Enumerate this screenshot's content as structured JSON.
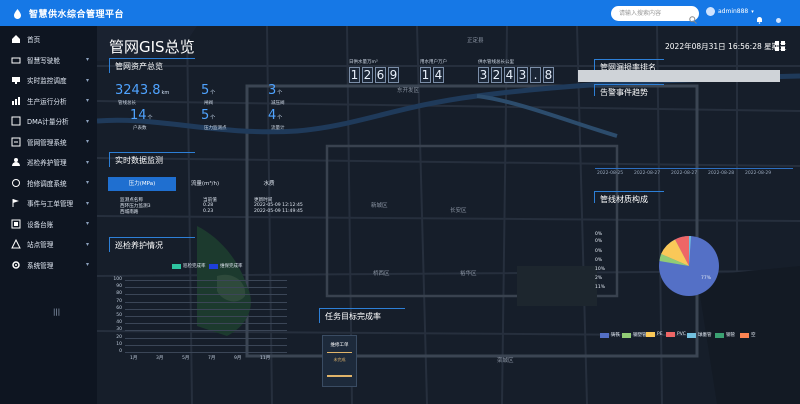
{
  "app": {
    "title": "智慧供水综合管理平台",
    "colors": {
      "topbar": "#1678e6",
      "accent": "#4fa3ff"
    }
  },
  "header": {
    "search_placeholder": "请输入搜索内容",
    "user": "admin888"
  },
  "sidebar": {
    "items": [
      {
        "label": "首页",
        "icon": "home-icon"
      },
      {
        "label": "智慧写驶舱",
        "icon": "cockpit-icon"
      },
      {
        "label": "实时监控调度",
        "icon": "monitor-icon"
      },
      {
        "label": "生产运行分析",
        "icon": "chart-icon"
      },
      {
        "label": "DMA计量分析",
        "icon": "dma-icon"
      },
      {
        "label": "管网管理系统",
        "icon": "pipe-icon"
      },
      {
        "label": "巡检养护管理",
        "icon": "person-icon"
      },
      {
        "label": "抢修调度系统",
        "icon": "repair-icon"
      },
      {
        "label": "事件与工单管理",
        "icon": "flag-icon"
      },
      {
        "label": "设备台账",
        "icon": "device-icon"
      },
      {
        "label": "站点管理",
        "icon": "station-icon"
      },
      {
        "label": "系统管理",
        "icon": "gear-icon"
      }
    ],
    "collapse_label": "|||"
  },
  "main": {
    "title": "管网GIS总览",
    "datetime": "2022年08月31日  16:56:28  星期三",
    "asset": {
      "title": "管网资产总览",
      "stats": [
        {
          "value": "3243.8",
          "unit": "km",
          "label": "管线总长"
        },
        {
          "value": "5",
          "unit": "个",
          "label": "闸阀"
        },
        {
          "value": "3",
          "unit": "个",
          "label": "减压阀"
        },
        {
          "value": "14",
          "unit": "个",
          "label": "户表数"
        },
        {
          "value": "5",
          "unit": "个",
          "label": "压力监测点"
        },
        {
          "value": "4",
          "unit": "个",
          "label": "流量计"
        }
      ]
    },
    "counters": [
      {
        "label": "日供水量万m³",
        "digits": [
          "1",
          "2",
          "6",
          "9"
        ]
      },
      {
        "label": "用水用户万户",
        "digits": [
          "1",
          "4"
        ]
      },
      {
        "label": "供水管线总长公里",
        "digits": [
          "3",
          "2",
          "4",
          "3",
          ".",
          " 8"
        ]
      }
    ],
    "realtime": {
      "title": "实时数据监测",
      "tabs": [
        "压力(MPa)",
        "流量(m³/h)",
        "水质"
      ],
      "headers": [
        "监测点名称",
        "当前值",
        "更新时间"
      ],
      "rows": [
        [
          "西环压力监测3",
          "0.28",
          "2022-05-09 12:12:45"
        ],
        [
          "西城南路",
          "0.23",
          "2022-05-09 11:49:45"
        ]
      ]
    },
    "inspection": {
      "title": "巡检养护情况",
      "legend": [
        "巡检完成率",
        "维保完成率"
      ],
      "yticks": [
        "100",
        "90",
        "80",
        "70",
        "60",
        "50",
        "40",
        "30",
        "20",
        "10",
        "0"
      ],
      "months": [
        "1月",
        "3月",
        "5月",
        "7月",
        "9月",
        "11月"
      ]
    },
    "task": {
      "title": "任务目标完成率",
      "card_title": "维修工单",
      "card_label": "未完成"
    },
    "rank": {
      "title": "管网漏损率排名"
    },
    "alarm": {
      "title": "告警事件趋势",
      "dates": [
        "2022-08-25",
        "2022-08-27",
        "2022-08-27",
        "2022-08-28",
        "2022-08-29"
      ]
    },
    "material": {
      "title": "管线材质构成",
      "slices_labels": [
        "0%",
        "0%",
        "0%",
        "0%",
        "10%",
        "2%",
        "11%",
        "77%"
      ],
      "legend": [
        {
          "name": "铸铁",
          "color": "#5470c6"
        },
        {
          "name": "钢塑管",
          "color": "#91cc75"
        },
        {
          "name": "PE",
          "color": "#fac858"
        },
        {
          "name": "PVC",
          "color": "#ee6666"
        },
        {
          "name": "球墨管",
          "color": "#73c0de"
        },
        {
          "name": "钢管",
          "color": "#3ba272"
        },
        {
          "name": "空",
          "color": "#fc8452"
        }
      ]
    },
    "map_places": [
      "新城区",
      "长安区",
      "桥西区",
      "裕华区",
      "正定县",
      "东开发区",
      "栾城区"
    ]
  }
}
